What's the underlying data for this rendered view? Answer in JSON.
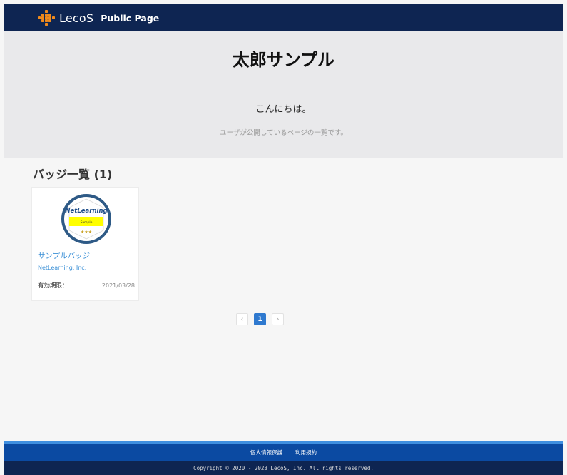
{
  "header": {
    "logo_text": "LecoS",
    "page_label": "Public Page"
  },
  "hero": {
    "title": "太郎サンプル",
    "greeting": "こんにちは。",
    "description": "ユーザが公開しているページの一覧です。"
  },
  "badges_section": {
    "title": "バッジ一覧 (1)",
    "items": [
      {
        "name": "サンプルバッジ",
        "issuer": "NetLearning, Inc.",
        "expiry_label": "有効期限：",
        "expiry_date": "2021/03/28",
        "image_text_brand": "NetLearning",
        "image_text_ribbon": "Sample",
        "image_stars": "★★★"
      }
    ]
  },
  "pagination": {
    "prev": "‹",
    "current": "1",
    "next": "›"
  },
  "footer": {
    "links": [
      "個人情報保護",
      "利用規約"
    ],
    "copyright": "Copyright © 2020 - 2023 LecoS, Inc. All rights reserved."
  },
  "colors": {
    "header_bg": "#0e2552",
    "footer_links_bg": "#0b4aa2",
    "accent_link": "#3a8fd6",
    "logo_orange": "#f08a1c",
    "active_page": "#2f79cf"
  }
}
